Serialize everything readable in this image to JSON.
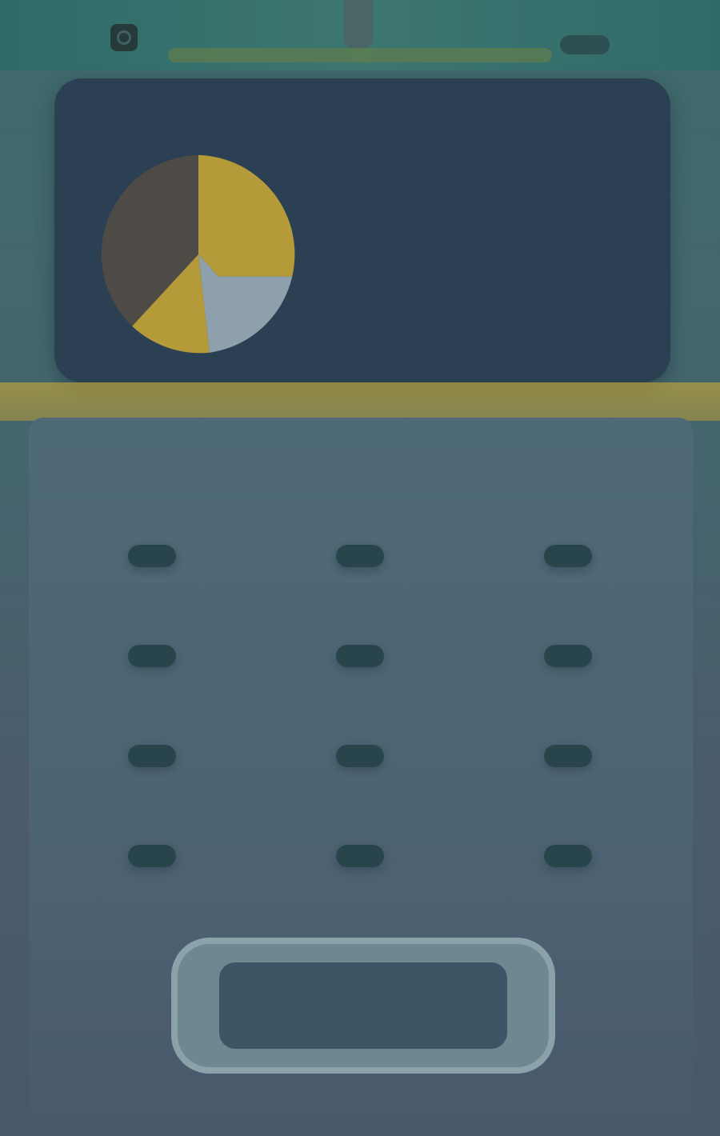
{
  "topbar": {
    "left_icon": "target-icon"
  },
  "hero": {
    "label_top": "",
    "label_gold": "",
    "label_mid": "",
    "label_big": "",
    "pie_colors": [
      "#4e4a46",
      "#b59a3a",
      "#8ea0ab"
    ]
  },
  "grid": {
    "buttons": [
      {
        "label": ""
      },
      {
        "label": ""
      },
      {
        "label": ""
      },
      {
        "label": ""
      },
      {
        "label": ""
      },
      {
        "label": ""
      },
      {
        "label": ""
      },
      {
        "label": ""
      },
      {
        "label": ""
      },
      {
        "label": ""
      },
      {
        "label": ""
      },
      {
        "label": ""
      }
    ]
  },
  "cta": {
    "label": ""
  },
  "colors": {
    "accent_gold": "#f2c42c",
    "hero_bg": "#2b4153",
    "panel_bg": "#4d6473"
  }
}
